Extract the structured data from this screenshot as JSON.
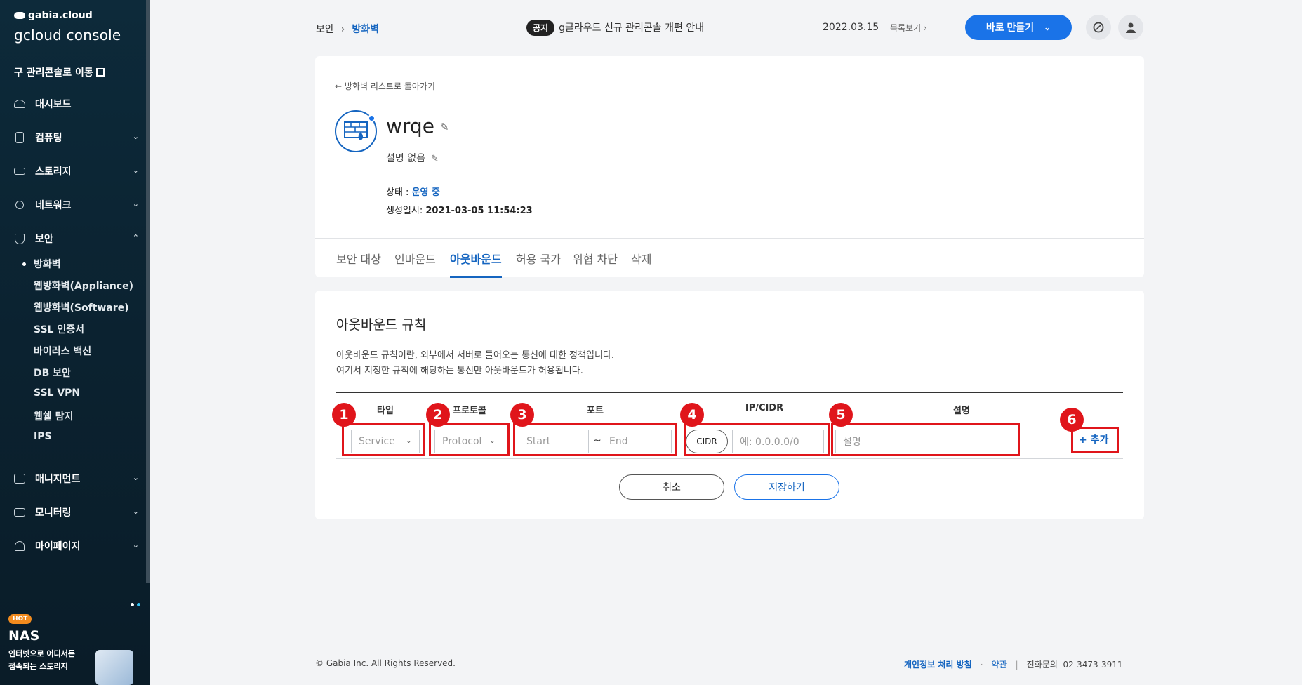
{
  "sidebar": {
    "brand_top": "gabia.cloud",
    "brand_main": "gcloud console",
    "legacy_link": "구 관리콘솔로 이동",
    "nav": [
      {
        "label": "대시보드",
        "icon": "dashboard-icon"
      },
      {
        "label": "컴퓨팅",
        "icon": "server-icon"
      },
      {
        "label": "스토리지",
        "icon": "storage-icon"
      },
      {
        "label": "네트워크",
        "icon": "network-icon"
      },
      {
        "label": "보안",
        "icon": "shield-icon"
      }
    ],
    "security_sub": [
      "방화벽",
      "웹방화벽(Appliance)",
      "웹방화벽(Software)",
      "SSL 인증서",
      "바이러스 백신",
      "DB 보안",
      "SSL VPN",
      "웹쉘 탐지",
      "IPS"
    ],
    "nav_bottom": [
      {
        "label": "매니지먼트",
        "icon": "management-icon"
      },
      {
        "label": "모니터링",
        "icon": "monitoring-icon"
      },
      {
        "label": "마이페이지",
        "icon": "user-icon"
      }
    ],
    "promo": {
      "badge": "HOT",
      "title": "NAS",
      "line1": "인터넷으로 어디서든",
      "line2": "접속되는 스토리지"
    }
  },
  "topbar": {
    "breadcrumb_parent": "보안",
    "breadcrumb_current": "방화벽",
    "notice_tag": "공지",
    "notice_text": "g클라우드 신규 관리콘솔 개편 안내",
    "notice_date": "2022.03.15",
    "notice_more": "목록보기",
    "create_button": "바로 만들기"
  },
  "detail": {
    "back_link": "방화벽 리스트로 돌아가기",
    "name": "wrqe",
    "description": "설명 없음",
    "status_label": "상태 : ",
    "status_value": "운영 중",
    "created_label": "생성일시: ",
    "created_value": "2021-03-05 11:54:23"
  },
  "tabs": [
    "보안 대상",
    "인바운드",
    "아웃바운드",
    "허용 국가",
    "위협 차단",
    "삭제"
  ],
  "active_tab": "아웃바운드",
  "rules": {
    "title": "아웃바운드 규칙",
    "desc1": "아웃바운드 규칙이란, 외부에서 서버로 들어오는 통신에 대한 정책입니다.",
    "desc2": "여기서 지정한 규칙에 해당하는 통신만 아웃바운드가 허용됩니다.",
    "headers": {
      "type": "타입",
      "protocol": "프로토콜",
      "port": "포트",
      "ip": "IP/CIDR",
      "desc": "설명"
    },
    "type_select": "Service",
    "protocol_select": "Protocol",
    "port_start_placeholder": "Start",
    "port_tilde": "~",
    "port_end_placeholder": "End",
    "cidr_button": "CIDR",
    "ip_placeholder": "예: 0.0.0.0/0",
    "desc_placeholder": "설명",
    "add_button": "+ 추가",
    "cancel_button": "취소",
    "save_button": "저장하기"
  },
  "annotations": [
    "1",
    "2",
    "3",
    "4",
    "5",
    "6"
  ],
  "footer": {
    "copyright": "© Gabia Inc. All Rights Reserved.",
    "privacy": "개인정보 처리 방침",
    "terms": "약관",
    "phone_label": "전화문의",
    "phone": "02-3473-3911"
  },
  "colors": {
    "accent": "#1a73e8",
    "sidebar_bg": "#0d2a3a",
    "annotation_red": "#e0151b"
  }
}
